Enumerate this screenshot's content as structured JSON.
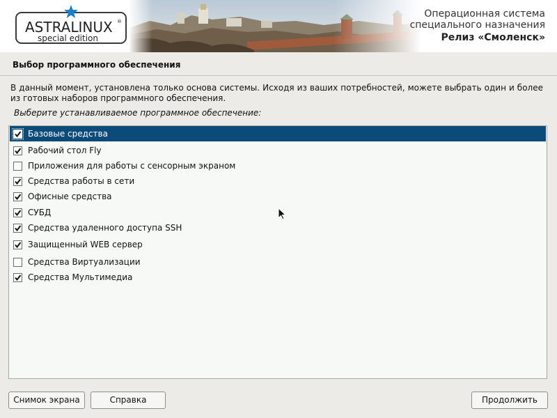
{
  "header": {
    "logo_name": "ASTRALINUX",
    "logo_registered": "®",
    "logo_edition": "special edition",
    "os_name_line1": "Операционная система",
    "os_name_line2": "специального назначения",
    "release": "Релиз «Смоленск»"
  },
  "page": {
    "title": "Выбор программного обеспечения",
    "description": "В данный момент, установлена только основа системы. Исходя из ваших потребностей, можете выбрать один и более из готовых наборов программного обеспечения.",
    "prompt": "Выберите устанавливаемое программное обеспечение:"
  },
  "software_list": {
    "items": [
      {
        "label": "Базовые средства",
        "checked": true,
        "selected": true
      },
      {
        "label": "Рабочий стол Fly",
        "checked": true,
        "selected": false
      },
      {
        "label": "Приложения для работы с сенсорным экраном",
        "checked": false,
        "selected": false
      },
      {
        "label": "Средства работы в сети",
        "checked": true,
        "selected": false
      },
      {
        "label": "Офисные средства",
        "checked": true,
        "selected": false
      },
      {
        "label": "СУБД",
        "checked": true,
        "selected": false
      },
      {
        "label": "Средства удаленного доступа SSH",
        "checked": true,
        "selected": false
      },
      {
        "label": "Защищенный WEB сервер",
        "checked": true,
        "selected": false
      },
      {
        "label": "Средства Виртуализации",
        "checked": false,
        "selected": false
      },
      {
        "label": "Средства Мультимедиа",
        "checked": true,
        "selected": false
      }
    ]
  },
  "buttons": {
    "screenshot": "Снимок экрана",
    "help": "Справка",
    "continue": "Продолжить"
  },
  "colors": {
    "selection": "#0c4a7a",
    "logo_star": "#1a7fc4",
    "background": "#ecebe7"
  }
}
